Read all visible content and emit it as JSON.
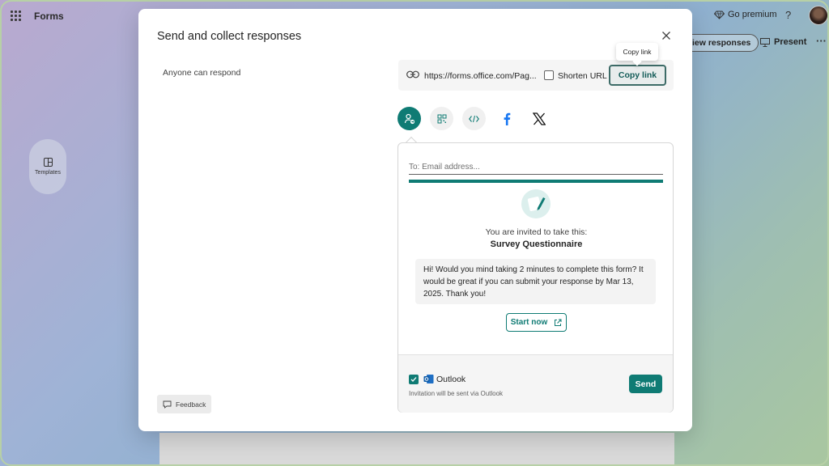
{
  "app": {
    "name": "Forms"
  },
  "header": {
    "go_premium": "Go premium",
    "help": "?",
    "view_responses": "iew responses",
    "present": "Present",
    "more": "···"
  },
  "sidebar": {
    "templates_label": "Templates"
  },
  "dialog": {
    "title": "Send and collect responses",
    "audience": "Anyone can respond",
    "link": {
      "url": "https://forms.office.com/Pag...",
      "shorten_label": "Shorten URL",
      "shorten_checked": false,
      "copy_label": "Copy link",
      "tooltip": "Copy link"
    },
    "share_icons": [
      "person-share-icon",
      "qr-code-icon",
      "embed-code-icon",
      "facebook-icon",
      "x-icon"
    ],
    "email": {
      "to_placeholder": "To: Email address...",
      "invite_line": "You are invited to take this:",
      "survey_title": "Survey Questionnaire",
      "message": "Hi! Would you mind taking 2 minutes to complete this form? It would be great if you can submit your response by Mar 13, 2025. Thank you!",
      "start_label": "Start now",
      "outlook_label": "Outlook",
      "outlook_checked": true,
      "outlook_note": "Invitation will be sent via Outlook",
      "send_label": "Send"
    },
    "feedback_label": "Feedback"
  },
  "colors": {
    "accent": "#0f7b74"
  }
}
